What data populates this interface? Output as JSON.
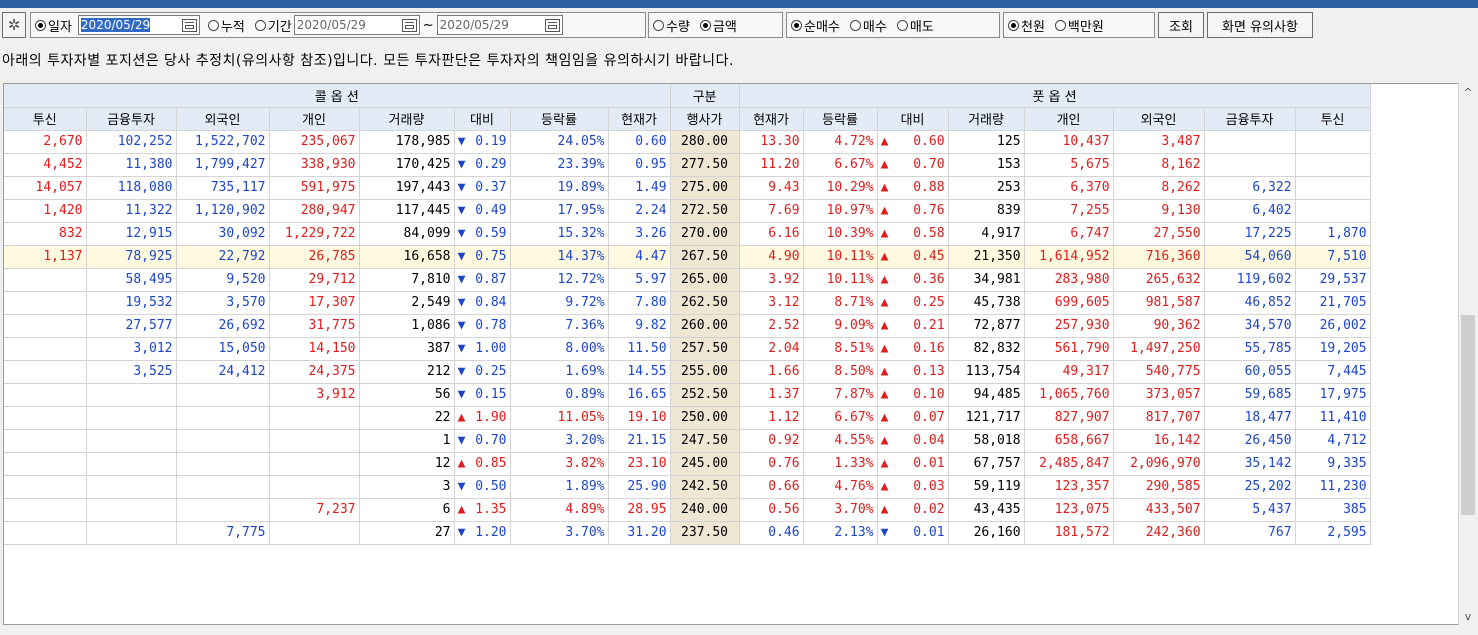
{
  "toolbar": {
    "gear_icon": "gear-icon",
    "mode": {
      "selected": "일자",
      "options": [
        "일자",
        "누적",
        "기간"
      ]
    },
    "date_single": "2020/05/29",
    "date_from": "2020/05/29",
    "date_sep": "~",
    "date_to": "2020/05/29",
    "measure": {
      "selected": "금액",
      "options": [
        "수량",
        "금액"
      ]
    },
    "trade_type": {
      "selected": "순매수",
      "options": [
        "순매수",
        "매수",
        "매도"
      ]
    },
    "unit": {
      "selected": "천원",
      "options": [
        "천원",
        "백만원"
      ]
    },
    "query_label": "조회",
    "notice_label": "화면 유의사항"
  },
  "notice_text": "아래의 투자자별 포지션은 당사 추정치(유의사항 참조)입니다. 모든 투자판단은 투자자의 책임임을 유의하시기 바랍니다.",
  "table": {
    "group_headers": {
      "call": "콜 옵 션",
      "strike": "구분",
      "put": "풋 옵 션"
    },
    "columns": [
      "투신",
      "금융투자",
      "외국인",
      "개인",
      "거래량",
      "대비",
      "등락률",
      "현재가",
      "행사가",
      "현재가",
      "등락률",
      "대비",
      "거래량",
      "개인",
      "외국인",
      "금융투자",
      "투신"
    ],
    "rows": [
      {
        "c_trust": "2,670",
        "c_fin": "102,252",
        "c_for": "1,522,702",
        "c_ind": "235,067",
        "c_vol": "178,985",
        "c_dir": "down",
        "c_chg": "0.19",
        "c_rate": "24.05%",
        "c_price": "0.60",
        "strike": "280.00",
        "p_price": "13.30",
        "p_rate": "4.72%",
        "p_dir": "up",
        "p_chg": "0.60",
        "p_vol": "125",
        "p_ind": "10,437",
        "p_for": "3,487",
        "p_fin": "",
        "p_trust": ""
      },
      {
        "c_trust": "4,452",
        "c_fin": "11,380",
        "c_for": "1,799,427",
        "c_ind": "338,930",
        "c_vol": "170,425",
        "c_dir": "down",
        "c_chg": "0.29",
        "c_rate": "23.39%",
        "c_price": "0.95",
        "strike": "277.50",
        "p_price": "11.20",
        "p_rate": "6.67%",
        "p_dir": "up",
        "p_chg": "0.70",
        "p_vol": "153",
        "p_ind": "5,675",
        "p_for": "8,162",
        "p_fin": "",
        "p_trust": ""
      },
      {
        "c_trust": "14,057",
        "c_fin": "118,080",
        "c_for": "735,117",
        "c_ind": "591,975",
        "c_vol": "197,443",
        "c_dir": "down",
        "c_chg": "0.37",
        "c_rate": "19.89%",
        "c_price": "1.49",
        "strike": "275.00",
        "p_price": "9.43",
        "p_rate": "10.29%",
        "p_dir": "up",
        "p_chg": "0.88",
        "p_vol": "253",
        "p_ind": "6,370",
        "p_for": "8,262",
        "p_fin": "6,322",
        "p_trust": ""
      },
      {
        "c_trust": "1,420",
        "c_fin": "11,322",
        "c_for": "1,120,902",
        "c_ind": "280,947",
        "c_vol": "117,445",
        "c_dir": "down",
        "c_chg": "0.49",
        "c_rate": "17.95%",
        "c_price": "2.24",
        "strike": "272.50",
        "p_price": "7.69",
        "p_rate": "10.97%",
        "p_dir": "up",
        "p_chg": "0.76",
        "p_vol": "839",
        "p_ind": "7,255",
        "p_for": "9,130",
        "p_fin": "6,402",
        "p_trust": ""
      },
      {
        "c_trust": "832",
        "c_fin": "12,915",
        "c_for": "30,092",
        "c_ind": "1,229,722",
        "c_vol": "84,099",
        "c_dir": "down",
        "c_chg": "0.59",
        "c_rate": "15.32%",
        "c_price": "3.26",
        "strike": "270.00",
        "p_price": "6.16",
        "p_rate": "10.39%",
        "p_dir": "up",
        "p_chg": "0.58",
        "p_vol": "4,917",
        "p_ind": "6,747",
        "p_for": "27,550",
        "p_fin": "17,225",
        "p_trust": "1,870"
      },
      {
        "c_trust": "1,137",
        "c_fin": "78,925",
        "c_for": "22,792",
        "c_ind": "26,785",
        "c_vol": "16,658",
        "c_dir": "down",
        "c_chg": "0.75",
        "c_rate": "14.37%",
        "c_price": "4.47",
        "strike": "267.50",
        "p_price": "4.90",
        "p_rate": "10.11%",
        "p_dir": "up",
        "p_chg": "0.45",
        "p_vol": "21,350",
        "p_ind": "1,614,952",
        "p_for": "716,360",
        "p_fin": "54,060",
        "p_trust": "7,510",
        "highlight": true
      },
      {
        "c_trust": "",
        "c_fin": "58,495",
        "c_for": "9,520",
        "c_ind": "29,712",
        "c_vol": "7,810",
        "c_dir": "down",
        "c_chg": "0.87",
        "c_rate": "12.72%",
        "c_price": "5.97",
        "strike": "265.00",
        "p_price": "3.92",
        "p_rate": "10.11%",
        "p_dir": "up",
        "p_chg": "0.36",
        "p_vol": "34,981",
        "p_ind": "283,980",
        "p_for": "265,632",
        "p_fin": "119,602",
        "p_trust": "29,537"
      },
      {
        "c_trust": "",
        "c_fin": "19,532",
        "c_for": "3,570",
        "c_ind": "17,307",
        "c_vol": "2,549",
        "c_dir": "down",
        "c_chg": "0.84",
        "c_rate": "9.72%",
        "c_price": "7.80",
        "strike": "262.50",
        "p_price": "3.12",
        "p_rate": "8.71%",
        "p_dir": "up",
        "p_chg": "0.25",
        "p_vol": "45,738",
        "p_ind": "699,605",
        "p_for": "981,587",
        "p_fin": "46,852",
        "p_trust": "21,705"
      },
      {
        "c_trust": "",
        "c_fin": "27,577",
        "c_for": "26,692",
        "c_ind": "31,775",
        "c_vol": "1,086",
        "c_dir": "down",
        "c_chg": "0.78",
        "c_rate": "7.36%",
        "c_price": "9.82",
        "strike": "260.00",
        "p_price": "2.52",
        "p_rate": "9.09%",
        "p_dir": "up",
        "p_chg": "0.21",
        "p_vol": "72,877",
        "p_ind": "257,930",
        "p_for": "90,362",
        "p_fin": "34,570",
        "p_trust": "26,002"
      },
      {
        "c_trust": "",
        "c_fin": "3,012",
        "c_for": "15,050",
        "c_ind": "14,150",
        "c_vol": "387",
        "c_dir": "down",
        "c_chg": "1.00",
        "c_rate": "8.00%",
        "c_price": "11.50",
        "strike": "257.50",
        "p_price": "2.04",
        "p_rate": "8.51%",
        "p_dir": "up",
        "p_chg": "0.16",
        "p_vol": "82,832",
        "p_ind": "561,790",
        "p_for": "1,497,250",
        "p_fin": "55,785",
        "p_trust": "19,205"
      },
      {
        "c_trust": "",
        "c_fin": "3,525",
        "c_for": "24,412",
        "c_ind": "24,375",
        "c_vol": "212",
        "c_dir": "down",
        "c_chg": "0.25",
        "c_rate": "1.69%",
        "c_price": "14.55",
        "strike": "255.00",
        "p_price": "1.66",
        "p_rate": "8.50%",
        "p_dir": "up",
        "p_chg": "0.13",
        "p_vol": "113,754",
        "p_ind": "49,317",
        "p_for": "540,775",
        "p_fin": "60,055",
        "p_trust": "7,445"
      },
      {
        "c_trust": "",
        "c_fin": "",
        "c_for": "",
        "c_ind": "3,912",
        "c_vol": "56",
        "c_dir": "down",
        "c_chg": "0.15",
        "c_rate": "0.89%",
        "c_price": "16.65",
        "strike": "252.50",
        "p_price": "1.37",
        "p_rate": "7.87%",
        "p_dir": "up",
        "p_chg": "0.10",
        "p_vol": "94,485",
        "p_ind": "1,065,760",
        "p_for": "373,057",
        "p_fin": "59,685",
        "p_trust": "17,975"
      },
      {
        "c_trust": "",
        "c_fin": "",
        "c_for": "",
        "c_ind": "",
        "c_vol": "22",
        "c_dir": "up",
        "c_chg": "1.90",
        "c_rate": "11.05%",
        "c_price": "19.10",
        "strike": "250.00",
        "p_price": "1.12",
        "p_rate": "6.67%",
        "p_dir": "up",
        "p_chg": "0.07",
        "p_vol": "121,717",
        "p_ind": "827,907",
        "p_for": "817,707",
        "p_fin": "18,477",
        "p_trust": "11,410"
      },
      {
        "c_trust": "",
        "c_fin": "",
        "c_for": "",
        "c_ind": "",
        "c_vol": "1",
        "c_dir": "down",
        "c_chg": "0.70",
        "c_rate": "3.20%",
        "c_price": "21.15",
        "strike": "247.50",
        "p_price": "0.92",
        "p_rate": "4.55%",
        "p_dir": "up",
        "p_chg": "0.04",
        "p_vol": "58,018",
        "p_ind": "658,667",
        "p_for": "16,142",
        "p_fin": "26,450",
        "p_trust": "4,712"
      },
      {
        "c_trust": "",
        "c_fin": "",
        "c_for": "",
        "c_ind": "",
        "c_vol": "12",
        "c_dir": "up",
        "c_chg": "0.85",
        "c_rate": "3.82%",
        "c_price": "23.10",
        "strike": "245.00",
        "p_price": "0.76",
        "p_rate": "1.33%",
        "p_dir": "up",
        "p_chg": "0.01",
        "p_vol": "67,757",
        "p_ind": "2,485,847",
        "p_for": "2,096,970",
        "p_fin": "35,142",
        "p_trust": "9,335"
      },
      {
        "c_trust": "",
        "c_fin": "",
        "c_for": "",
        "c_ind": "",
        "c_vol": "3",
        "c_dir": "down",
        "c_chg": "0.50",
        "c_rate": "1.89%",
        "c_price": "25.90",
        "strike": "242.50",
        "p_price": "0.66",
        "p_rate": "4.76%",
        "p_dir": "up",
        "p_chg": "0.03",
        "p_vol": "59,119",
        "p_ind": "123,357",
        "p_for": "290,585",
        "p_fin": "25,202",
        "p_trust": "11,230"
      },
      {
        "c_trust": "",
        "c_fin": "",
        "c_for": "",
        "c_ind": "7,237",
        "c_vol": "6",
        "c_dir": "up",
        "c_chg": "1.35",
        "c_rate": "4.89%",
        "c_price": "28.95",
        "strike": "240.00",
        "p_price": "0.56",
        "p_rate": "3.70%",
        "p_dir": "up",
        "p_chg": "0.02",
        "p_vol": "43,435",
        "p_ind": "123,075",
        "p_for": "433,507",
        "p_fin": "5,437",
        "p_trust": "385"
      },
      {
        "c_trust": "",
        "c_fin": "",
        "c_for": "7,775",
        "c_ind": "",
        "c_vol": "27",
        "c_dir": "down",
        "c_chg": "1.20",
        "c_rate": "3.70%",
        "c_price": "31.20",
        "strike": "237.50",
        "p_price": "0.46",
        "p_rate": "2.13%",
        "p_dir": "down",
        "p_chg": "0.01",
        "p_vol": "26,160",
        "p_ind": "181,572",
        "p_for": "242,360",
        "p_fin": "767",
        "p_trust": "2,595"
      }
    ]
  },
  "colors": {
    "up": "#e21b1b",
    "down": "#1d45c9",
    "header_bg": "#e3ecf6",
    "strike_bg": "#efe6d4",
    "highlight_row": "#fffadf",
    "titlebar": "#2a5fa0"
  }
}
